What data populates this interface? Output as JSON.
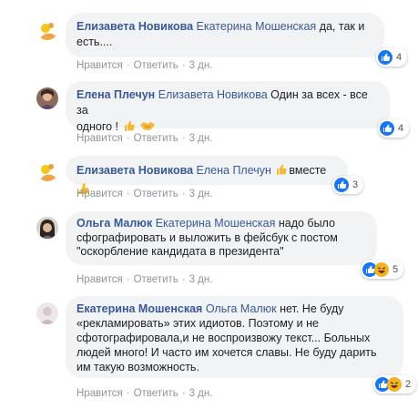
{
  "comments": [
    {
      "author": "Елизавета Новикова",
      "mention": "Екатерина Мошенская",
      "line1": "да, так и",
      "line2": "есть....",
      "like": "Нравится",
      "reply": "Ответить",
      "time": "3 дн.",
      "reaction_count": "4"
    },
    {
      "author": "Елена Плечун",
      "mention": "Елизавета Новикова",
      "line1": "Один за всех - все за",
      "line2": "одного !",
      "like": "Нравится",
      "reply": "Ответить",
      "time": "3 дн.",
      "reaction_count": "4"
    },
    {
      "author": "Елизавета Новикова",
      "mention": "Елена Плечун",
      "line1": "вместе",
      "like": "Нравится",
      "reply": "Ответить",
      "time": "3 дн.",
      "reaction_count": "3"
    },
    {
      "author": "Ольга Малюк",
      "mention": "Екатерина Мошенская",
      "line1": "надо было",
      "line2": "сфографировать и выложить в фейсбук с постом",
      "line3": "\"оскорбление кандидата в президента\"",
      "like": "Нравится",
      "reply": "Ответить",
      "time": "3 дн.",
      "reaction_count": "5"
    },
    {
      "author": "Екатерина Мошенская",
      "mention": "Ольга Малюк",
      "line1": "нет. Не буду",
      "line2": "«рекламировать» этих идиотов. Поэтому и не",
      "line3": "сфотографировала,и не воспроизвожу текст... Больных",
      "line4": "людей много! И часто им хочется славы. Не буду дарить",
      "line5": "им такую возможность.",
      "like": "Нравится",
      "reply": "Ответить",
      "time": "3 дн.",
      "reaction_count": "2"
    }
  ],
  "colors": {
    "link": "#385898",
    "bubble": "#f2f3f5",
    "like_blue": "#1877f2",
    "haha_yellow": "#f7b125",
    "meta": "#90949c"
  },
  "icons": [
    "avatar-1",
    "avatar-2",
    "avatar-3",
    "avatar-4",
    "avatar-5",
    "like-icon",
    "haha-icon",
    "thumbs-up-emoji",
    "handshake-emoji",
    "flexed-biceps-emoji"
  ]
}
